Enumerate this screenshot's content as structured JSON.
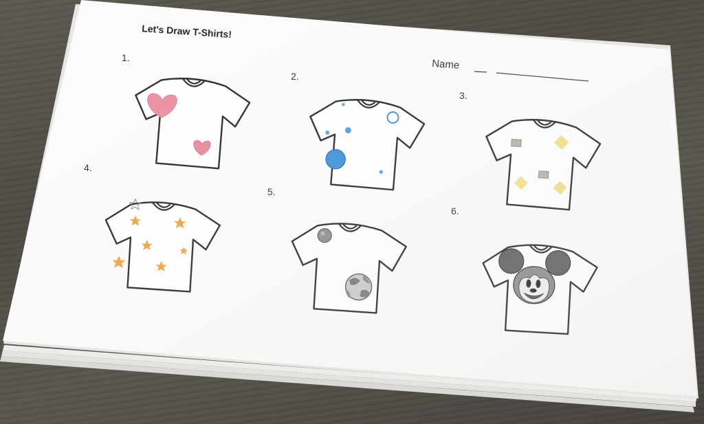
{
  "worksheet": {
    "title": "Let's Draw T-Shirts!",
    "name_label": "Name",
    "items": [
      {
        "number": "1.",
        "design": "pink hearts"
      },
      {
        "number": "2.",
        "design": "blue circles"
      },
      {
        "number": "3.",
        "design": "yellow and gray squares"
      },
      {
        "number": "4.",
        "design": "orange stars"
      },
      {
        "number": "5.",
        "design": "gray balls"
      },
      {
        "number": "6.",
        "design": "mouse face"
      }
    ]
  },
  "colors": {
    "paper": "#fbfbfb",
    "desk": "#55524b",
    "heart_pink": "#ea8ea0",
    "circle_blue": "#3b8fd6",
    "square_yellow": "#f1df8a",
    "square_gray": "#9a9590",
    "star_orange": "#eba144",
    "ball_gray": "#8c8c8c"
  }
}
